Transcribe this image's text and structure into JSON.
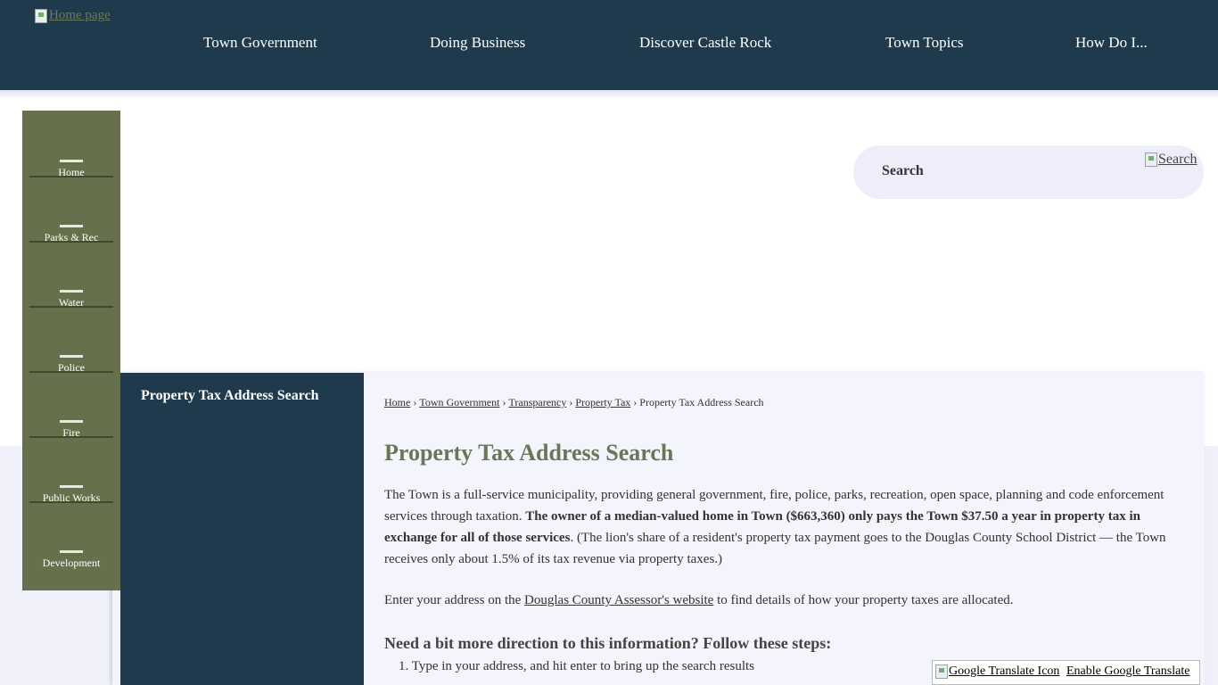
{
  "header": {
    "logo_alt": "Home page",
    "nav": [
      {
        "label": "Town Government"
      },
      {
        "label": "Doing Business"
      },
      {
        "label": "Discover Castle Rock"
      },
      {
        "label": "Town Topics"
      },
      {
        "label": "How Do I..."
      }
    ]
  },
  "quicklinks": [
    {
      "label": "Home"
    },
    {
      "label": "Parks & Rec"
    },
    {
      "label": "Water"
    },
    {
      "label": "Police"
    },
    {
      "label": "Fire"
    },
    {
      "label": "Public Works"
    },
    {
      "label": "Development"
    }
  ],
  "search": {
    "label": "Search",
    "button_alt": "Search"
  },
  "sidenav": {
    "title": "Property Tax Address Search"
  },
  "breadcrumb": {
    "items": [
      "Home",
      "Town Government",
      "Transparency",
      "Property Tax"
    ],
    "current": "Property Tax Address Search",
    "separator": "›"
  },
  "content": {
    "title": "Property Tax Address Search",
    "p1_a": "The Town is a full-service municipality, providing general government, fire, police, parks, recreation, open space, planning and code enforcement services through taxation. ",
    "p1_bold": "The owner of a median-valued home in Town ($663,360) only pays the Town $37.50 a year in property tax in exchange for all of those services",
    "p1_b": ". (The lion's share of a resident's property tax payment goes to the Douglas County School District — the Town receives only about 1.5% of its tax revenue via property taxes.)",
    "p2_a": "Enter your address on the ",
    "p2_link": "Douglas County Assessor's website",
    "p2_b": " to find details of how your property taxes are allocated.",
    "subhead": "Need a bit more direction to this information? Follow these steps:",
    "step1_num": "1.",
    "step1": "Type in your address, and hit enter to bring up the search results"
  },
  "translate": {
    "icon_alt": "Google Translate Icon",
    "link": "Enable Google Translate"
  },
  "colors": {
    "header_bg": "#203a4d",
    "quicklinks_bg": "#67704c",
    "title_green": "#6a7757",
    "panel_bg": "#f3f4fc"
  }
}
